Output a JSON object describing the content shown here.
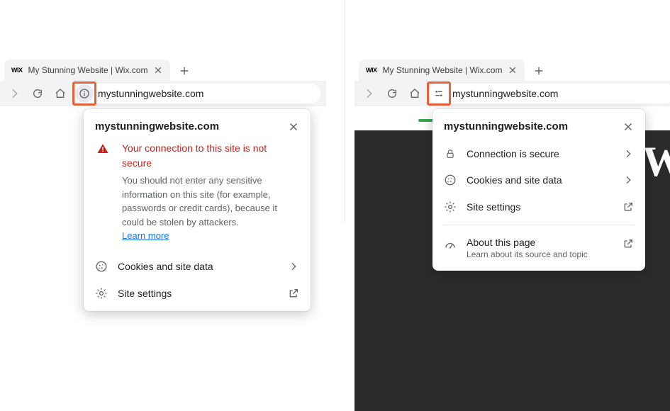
{
  "left": {
    "tab": {
      "favicon": "WIX",
      "title": "My Stunning Website | Wix.com"
    },
    "url": "mystunningwebsite.com",
    "popup": {
      "title": "mystunningwebsite.com",
      "warning_title": "Your connection to this site is not secure",
      "warning_text": "You should not enter any sensitive information on this site (for example, passwords or credit cards), because it could be stolen by attackers.",
      "learn_more": "Learn more",
      "rows": {
        "cookies": "Cookies and site data",
        "settings": "Site settings"
      }
    }
  },
  "right": {
    "tab": {
      "favicon": "WIX",
      "title": "My Stunning Website | Wix.com"
    },
    "url": "mystunningwebsite.com",
    "popup": {
      "title": "mystunningwebsite.com",
      "rows": {
        "secure": "Connection is secure",
        "cookies": "Cookies and site data",
        "settings": "Site settings",
        "about": "About this page",
        "about_sub": "Learn about its source and topic"
      }
    }
  }
}
